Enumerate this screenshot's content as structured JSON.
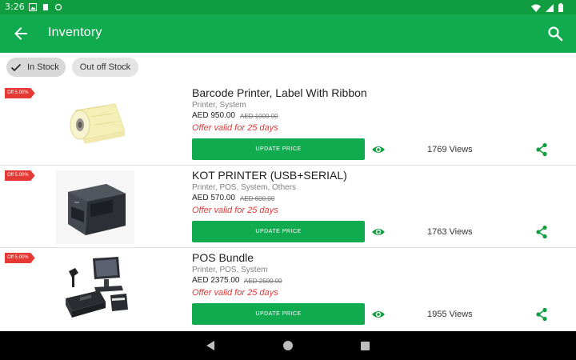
{
  "status_bar": {
    "time": "3:26"
  },
  "app_bar": {
    "title": "Inventory"
  },
  "filters": [
    {
      "label": "In Stock",
      "selected": true
    },
    {
      "label": "Out off Stock",
      "selected": false
    }
  ],
  "products": [
    {
      "badge": "Off 5.00%",
      "image": "label-roll",
      "title": "Barcode Printer, Label With Ribbon",
      "categories": "Printer, System",
      "price": "AED 950.00",
      "old_price": "AED 1000.00",
      "offer": "Offer valid for 25 days",
      "button_label": "UPDATE PRICE",
      "views": "1769 Views"
    },
    {
      "badge": "Off 5.00%",
      "image": "kot-printer",
      "title": "KOT PRINTER (USB+SERIAL)",
      "categories": "Printer, POS, System, Others",
      "price": "AED 570.00",
      "old_price": "AED 600.00",
      "offer": "Offer valid for 25 days",
      "button_label": "UPDATE PRICE",
      "views": "1763 Views"
    },
    {
      "badge": "Off 5.00%",
      "image": "pos-bundle",
      "title": "POS Bundle",
      "categories": "Printer, POS, System",
      "price": "AED 2375.00",
      "old_price": "AED 2500.00",
      "offer": "Offer valid for 25 days",
      "button_label": "UPDATE PRICE",
      "views": "1955 Views"
    }
  ],
  "colors": {
    "primary": "#10ab4f",
    "status_bar": "#0f9d3f",
    "accent_red": "#e53935",
    "icon_green": "#0f9d3f"
  }
}
